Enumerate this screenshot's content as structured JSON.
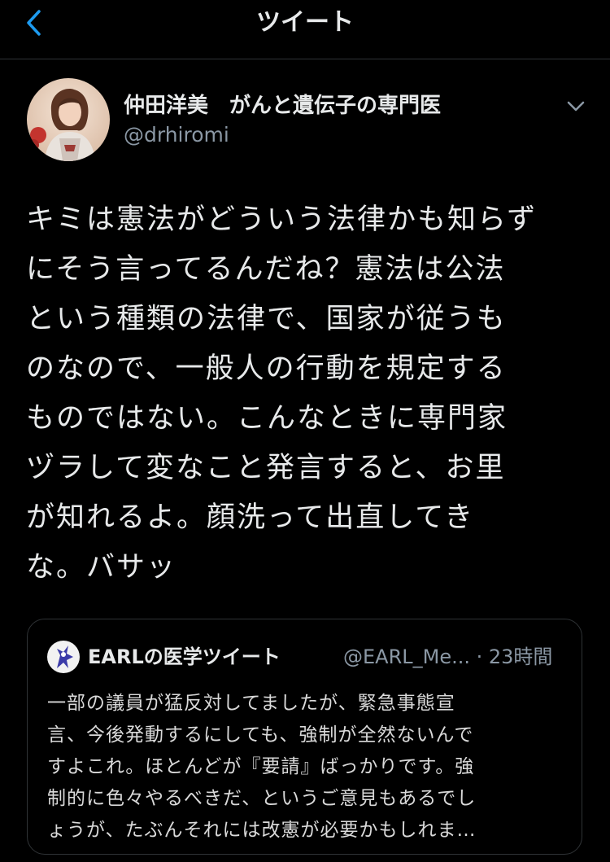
{
  "header": {
    "title": "ツイート",
    "back_icon": "chevron-left-icon",
    "accent_color": "#1d9bf0"
  },
  "tweet": {
    "author": {
      "display_name": "仲田洋美　がんと遺伝子の専門医",
      "handle": "@drhiromi",
      "avatar_icon": "profile-avatar"
    },
    "menu_icon": "chevron-down-icon",
    "text_lines": [
      "キミは憲法がどういう法律かも知らず",
      "にそう言ってるんだね？憲法は公法",
      "という種類の法律で、国家が従うも",
      "のなので、一般人の行動を規定する",
      "ものではない。こんなときに専門家",
      "ヅラして変なこと発言すると、お里",
      "が知れるよ。顔洗って出直してき",
      "な。バサッ"
    ]
  },
  "quote": {
    "author": {
      "display_name": "EARLの医学ツイート",
      "handle_time": "@EARL_Me... · 23時間",
      "avatar_icon": "earl-avatar"
    },
    "text_lines": [
      "一部の議員が猛反対してましたが、緊急事態宣",
      "言、今後発動するにしても、強制が全然ないんで",
      "すよこれ。ほとんどが『要請』ばっかりです。強",
      "制的に色々やるべきだ、というご意見もあるでし",
      "ょうが、たぶんそれには改憲が必要かもしれま…"
    ]
  }
}
